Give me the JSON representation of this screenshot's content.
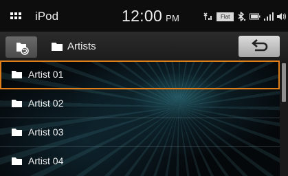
{
  "status_bar": {
    "source": "iPod",
    "time": "12:00",
    "ampm": "PM",
    "eq_badge": "Flat",
    "icons": [
      "menu-grid-icon",
      "antenna-signal-icon",
      "bluetooth-icon",
      "battery-icon",
      "signal-bars-icon",
      "volume-icon"
    ]
  },
  "navbar": {
    "breadcrumb": "Artists",
    "icons": [
      "folder-refresh-icon",
      "folder-icon",
      "back-arrow-icon"
    ]
  },
  "list": {
    "items": [
      {
        "label": "Artist 01",
        "selected": true
      },
      {
        "label": "Artist 02",
        "selected": false
      },
      {
        "label": "Artist 03",
        "selected": false
      },
      {
        "label": "Artist 04",
        "selected": false
      }
    ]
  },
  "colors": {
    "selection": "#e07f1a",
    "status_bg": "#0d0d0d"
  }
}
